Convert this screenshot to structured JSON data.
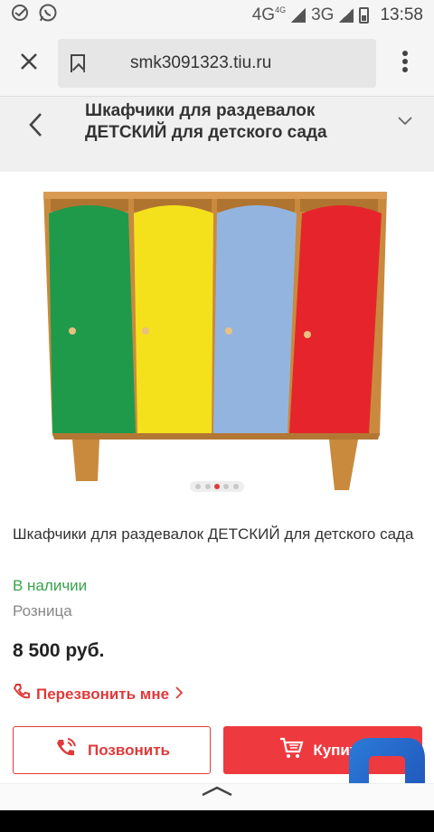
{
  "status_bar": {
    "network_4g": "4G",
    "network_4g_sup": "4G",
    "network_3g": "3G",
    "time": "13:58"
  },
  "browser": {
    "url": "smk3091323.tiu.ru",
    "close_icon": "close-icon",
    "bookmark_icon": "bookmark-icon",
    "menu_icon": "more-vert-icon"
  },
  "page": {
    "title": "Шкафчики для раздевалок ДЕТСКИЙ для детского сада"
  },
  "product": {
    "name": "Шкафчики для раздевалок ДЕТСКИЙ для детского сада",
    "availability": "В наличии",
    "price_type": "Розница",
    "price": "8 500 руб.",
    "callback_label": "Перезвонить мне",
    "carousel_active_index": 2,
    "carousel_total": 5
  },
  "actions": {
    "call_label": "Позвонить",
    "buy_label": "Купить"
  },
  "colors": {
    "accent_red": "#ee3a3f",
    "green_text": "#3aa24b",
    "locker_green": "#1f9a4a",
    "locker_yellow": "#f4e11c",
    "locker_blue": "#94b4e0",
    "locker_red": "#e5252b",
    "frame": "#c98a3e"
  }
}
